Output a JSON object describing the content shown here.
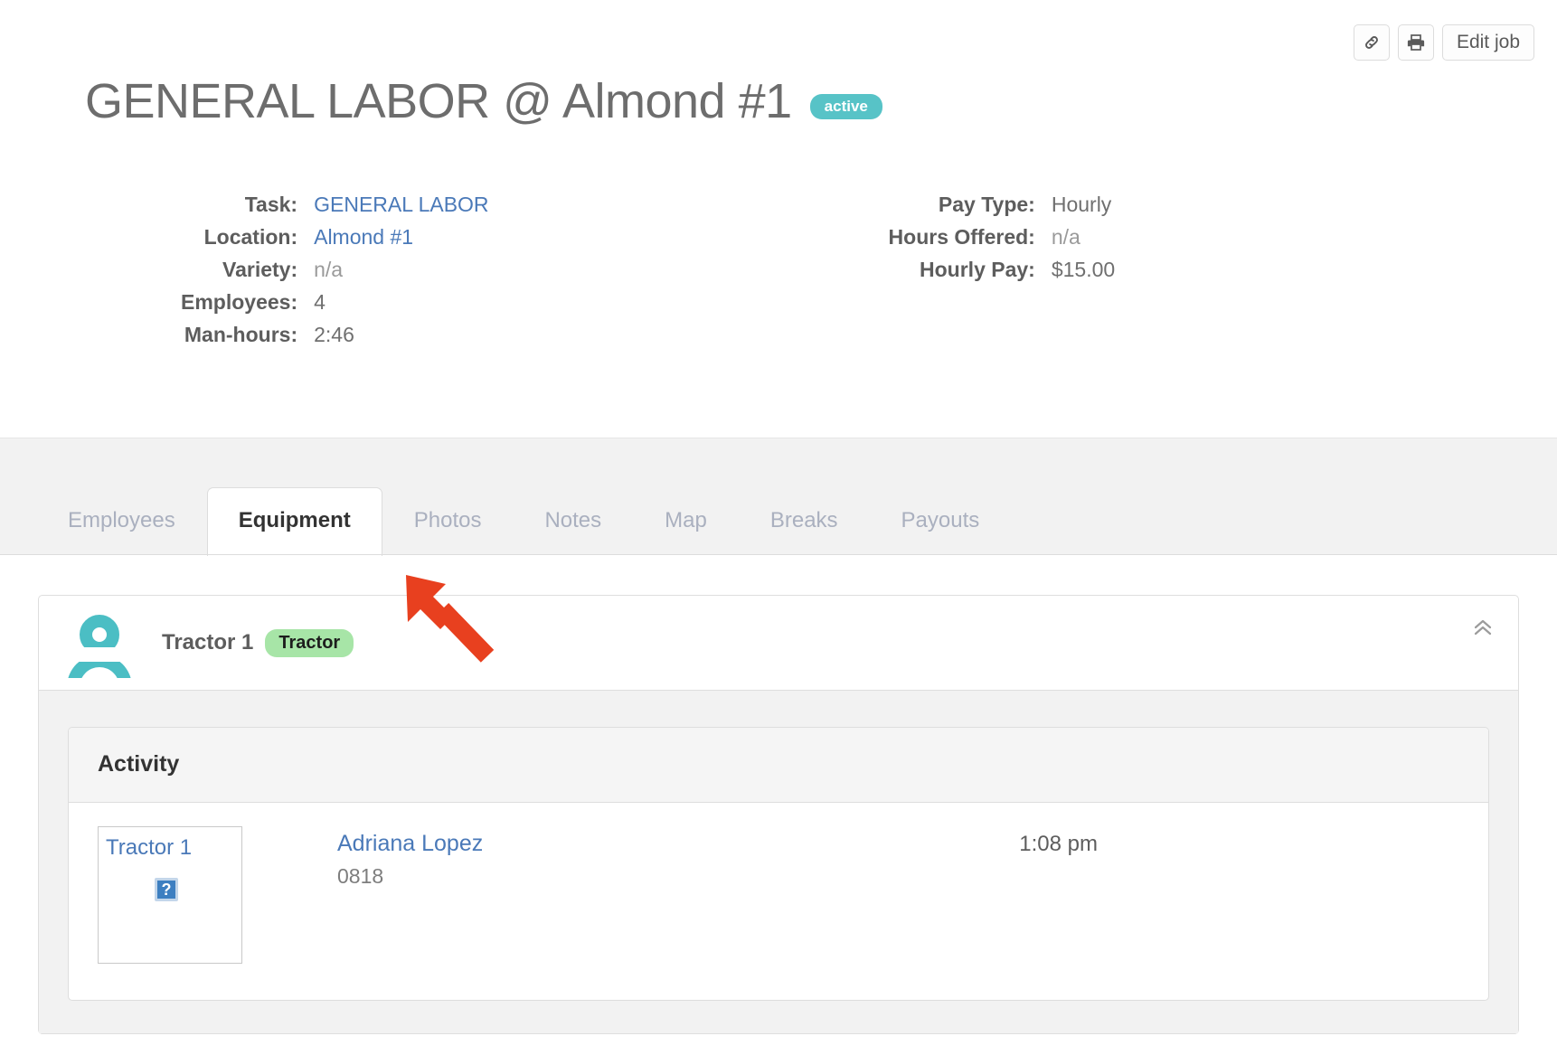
{
  "toolbar": {
    "link_icon": "link-icon",
    "print_icon": "printer-icon",
    "edit_label": "Edit job"
  },
  "header": {
    "title": "GENERAL LABOR @ Almond #1",
    "status": "active",
    "status_color": "#57c3c7"
  },
  "info": {
    "left": [
      {
        "label": "Task:",
        "value": "GENERAL LABOR",
        "style": "link"
      },
      {
        "label": "Location:",
        "value": "Almond #1",
        "style": "link"
      },
      {
        "label": "Variety:",
        "value": "n/a",
        "style": "muted"
      },
      {
        "label": "Employees:",
        "value": "4",
        "style": "plain"
      },
      {
        "label": "Man-hours:",
        "value": "2:46",
        "style": "plain"
      }
    ],
    "right": [
      {
        "label": "Pay Type:",
        "value": "Hourly",
        "style": "plain"
      },
      {
        "label": "Hours Offered:",
        "value": "n/a",
        "style": "muted"
      },
      {
        "label": "Hourly Pay:",
        "value": "$15.00",
        "style": "plain"
      }
    ]
  },
  "tabs": [
    {
      "label": "Employees",
      "active": false
    },
    {
      "label": "Equipment",
      "active": true
    },
    {
      "label": "Photos",
      "active": false
    },
    {
      "label": "Notes",
      "active": false
    },
    {
      "label": "Map",
      "active": false
    },
    {
      "label": "Breaks",
      "active": false
    },
    {
      "label": "Payouts",
      "active": false
    }
  ],
  "equipment_card": {
    "name": "Tractor 1",
    "type_badge": "Tractor",
    "badge_color": "#a7e5a7",
    "avatar_color": "#4bbec4",
    "collapse_icon": "chevron-double-up-icon"
  },
  "activity": {
    "panel_title": "Activity",
    "rows": [
      {
        "thumb_alt": "Tractor 1",
        "broken_image_glyph": "?",
        "person": "Adriana Lopez",
        "detail": "0818",
        "time": "1:08 pm"
      }
    ]
  },
  "annotation": {
    "arrow_color": "#e8401f"
  }
}
